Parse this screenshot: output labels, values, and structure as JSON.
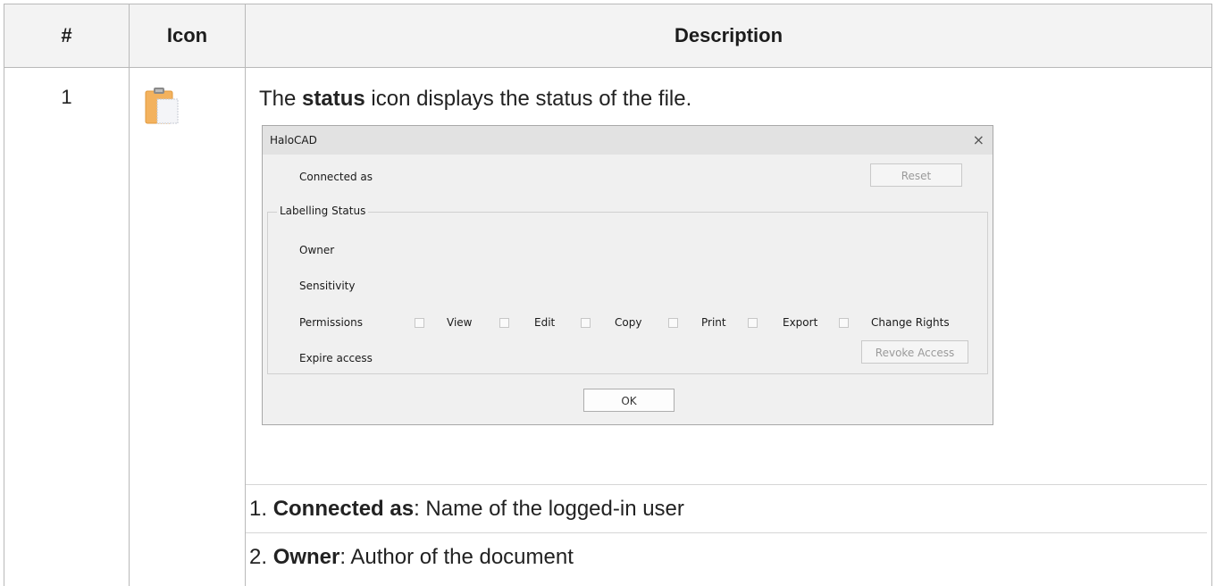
{
  "table": {
    "headers": {
      "number": "#",
      "icon": "Icon",
      "description": "Description"
    },
    "row": {
      "number": "1",
      "icon_name": "status-clipboard-icon",
      "intro_before": "The ",
      "intro_bold": "status",
      "intro_after": " icon displays the status of the file.",
      "list": [
        {
          "index": "1. ",
          "term": "Connected as",
          "text": ": Name of the logged-in user"
        },
        {
          "index": "2. ",
          "term": "Owner",
          "text": ": Author of the document"
        }
      ]
    }
  },
  "dialog": {
    "title": "HaloCAD",
    "close_glyph": "×",
    "connected_as_label": "Connected as",
    "reset_button": "Reset",
    "group_title": "Labelling Status",
    "owner_label": "Owner",
    "sensitivity_label": "Sensitivity",
    "permissions_label": "Permissions",
    "permissions": [
      "View",
      "Edit",
      "Copy",
      "Print",
      "Export",
      "Change Rights"
    ],
    "expire_access_label": "Expire access",
    "revoke_button": "Revoke Access",
    "ok_button": "OK"
  }
}
